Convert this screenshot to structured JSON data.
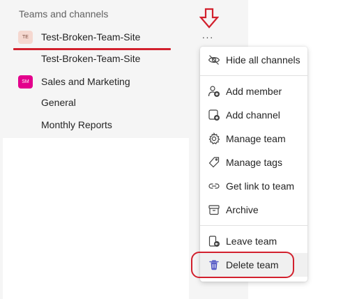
{
  "sidebar": {
    "section_title": "Teams and channels",
    "teams": [
      {
        "name": "Test-Broken-Team-Site",
        "avatar_initials": "TE",
        "channels": [
          "Test-Broken-Team-Site"
        ]
      },
      {
        "name": "Sales and Marketing",
        "avatar_initials": "SM",
        "channels": [
          "General",
          "Monthly Reports"
        ]
      }
    ],
    "more_button_label": "···"
  },
  "context_menu": {
    "items": [
      {
        "label": "Hide all channels",
        "icon": "eye-off-icon"
      },
      {
        "label": "Add member",
        "icon": "person-add-icon"
      },
      {
        "label": "Add channel",
        "icon": "channel-add-icon"
      },
      {
        "label": "Manage team",
        "icon": "gear-icon"
      },
      {
        "label": "Manage tags",
        "icon": "tag-icon"
      },
      {
        "label": "Get link to team",
        "icon": "link-icon"
      },
      {
        "label": "Archive",
        "icon": "archive-icon"
      },
      {
        "label": "Leave team",
        "icon": "leave-icon"
      },
      {
        "label": "Delete team",
        "icon": "trash-icon"
      }
    ],
    "highlighted_item": "Delete team"
  },
  "colors": {
    "annotation_red": "#d2202d",
    "delete_icon": "#5b5fc7",
    "avatar_sm": "#e3008c",
    "avatar_te": "#f5d8d0"
  }
}
